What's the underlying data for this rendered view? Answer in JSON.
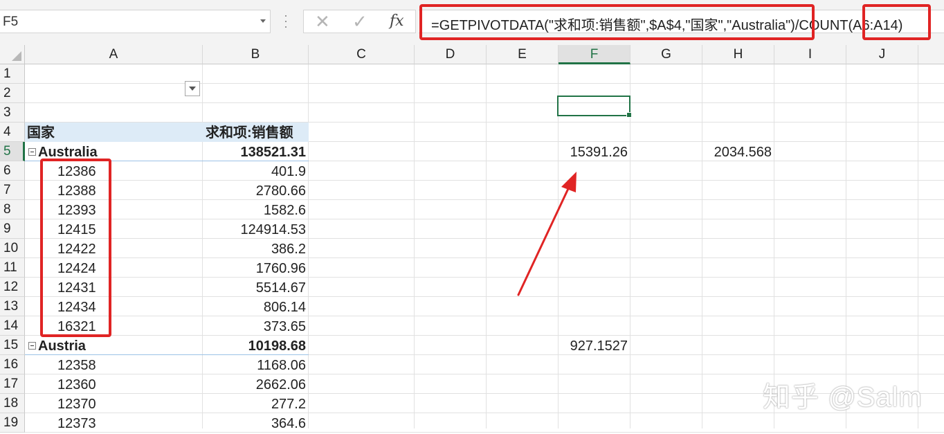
{
  "name_box": "F5",
  "toolbar": {
    "cancel": "✕",
    "enter": "✓",
    "fx": "fx"
  },
  "formula": "=GETPIVOTDATA(\"求和项:销售额\",$A$4,\"国家\",\"Australia\")/COUNT(A6:A14)",
  "columns": [
    "A",
    "B",
    "C",
    "D",
    "E",
    "F",
    "G",
    "H",
    "I",
    "J"
  ],
  "selected_column": "F",
  "selected_row": "5",
  "rows": [
    "1",
    "2",
    "3",
    "4",
    "5",
    "6",
    "7",
    "8",
    "9",
    "10",
    "11",
    "12",
    "13",
    "14",
    "15",
    "16",
    "17",
    "18",
    "19"
  ],
  "pivot": {
    "header_country": "国家",
    "header_sum": "求和项:销售额",
    "groups": [
      {
        "name": "Australia",
        "total": "138521.31",
        "items": [
          {
            "id": "12386",
            "value": "401.9"
          },
          {
            "id": "12388",
            "value": "2780.66"
          },
          {
            "id": "12393",
            "value": "1582.6"
          },
          {
            "id": "12415",
            "value": "124914.53"
          },
          {
            "id": "12422",
            "value": "386.2"
          },
          {
            "id": "12424",
            "value": "1760.96"
          },
          {
            "id": "12431",
            "value": "5514.67"
          },
          {
            "id": "12434",
            "value": "806.14"
          },
          {
            "id": "16321",
            "value": "373.65"
          }
        ]
      },
      {
        "name": "Austria",
        "total": "10198.68",
        "items": [
          {
            "id": "12358",
            "value": "1168.06"
          },
          {
            "id": "12360",
            "value": "2662.06"
          },
          {
            "id": "12370",
            "value": "277.2"
          },
          {
            "id": "12373",
            "value": "364.6"
          }
        ]
      }
    ]
  },
  "cells": {
    "F5": "15391.26",
    "H5": "2034.568",
    "F15": "927.1527"
  },
  "watermark": "知乎 @Salm",
  "colors": {
    "highlight": "#e02424",
    "excel_green": "#217346",
    "pivot_header": "#ddebf7"
  }
}
